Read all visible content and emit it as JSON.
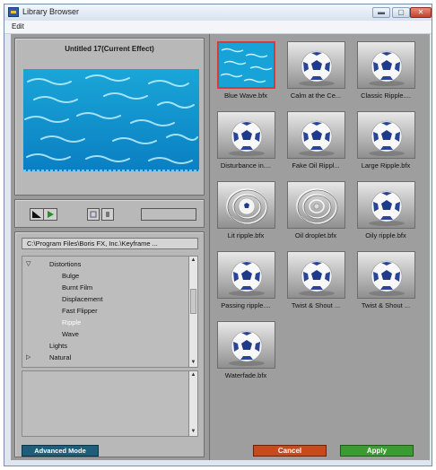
{
  "window": {
    "title": "Library Browser",
    "menu": [
      "Edit"
    ]
  },
  "preview": {
    "title": "Untitled 17(Current Effect)"
  },
  "controls": {
    "icons": [
      "frame-icon",
      "play-icon",
      "grid-icon",
      "single-icon"
    ]
  },
  "browser": {
    "path": "C:\\Program Files\\Boris FX, Inc.\\Keyframe ...",
    "tree": [
      {
        "label": "Distortions",
        "level": 0,
        "expanded": true
      },
      {
        "label": "Bulge",
        "level": 1
      },
      {
        "label": "Burnt Film",
        "level": 1
      },
      {
        "label": "Displacement",
        "level": 1
      },
      {
        "label": "Fast Flipper",
        "level": 1
      },
      {
        "label": "Ripple",
        "level": 1,
        "selected": true
      },
      {
        "label": "Wave",
        "level": 1
      },
      {
        "label": "Lights",
        "level": 0
      },
      {
        "label": "Natural",
        "level": 0,
        "expanded": false
      }
    ]
  },
  "advanced_mode_label": "Advanced Mode",
  "library": {
    "items": [
      {
        "label": "Blue Wave.bfx",
        "thumb": "water",
        "selected": true
      },
      {
        "label": "Calm at the Ce...",
        "thumb": "ball"
      },
      {
        "label": "Classic Ripple....",
        "thumb": "ball"
      },
      {
        "label": "Disturbance in....",
        "thumb": "ball"
      },
      {
        "label": "Fake Oil Rippl...",
        "thumb": "ball"
      },
      {
        "label": "Large Ripple.bfx",
        "thumb": "ball"
      },
      {
        "label": "Lit ripple.bfx",
        "thumb": "ball-rings"
      },
      {
        "label": "Oil droplet.bfx",
        "thumb": "rings"
      },
      {
        "label": "Oily ripple.bfx",
        "thumb": "ball"
      },
      {
        "label": "Passing ripple....",
        "thumb": "ball"
      },
      {
        "label": "Twist & Shout ...",
        "thumb": "ball"
      },
      {
        "label": "Twist & Shout ...",
        "thumb": "ball"
      },
      {
        "label": "Waterfade.bfx",
        "thumb": "ball"
      }
    ]
  },
  "buttons": {
    "cancel": "Cancel",
    "apply": "Apply"
  },
  "colors": {
    "cancel": "#c84a1c",
    "apply": "#3c9a32",
    "advanced": "#1f5e7a",
    "selection": "#d83a3a"
  }
}
